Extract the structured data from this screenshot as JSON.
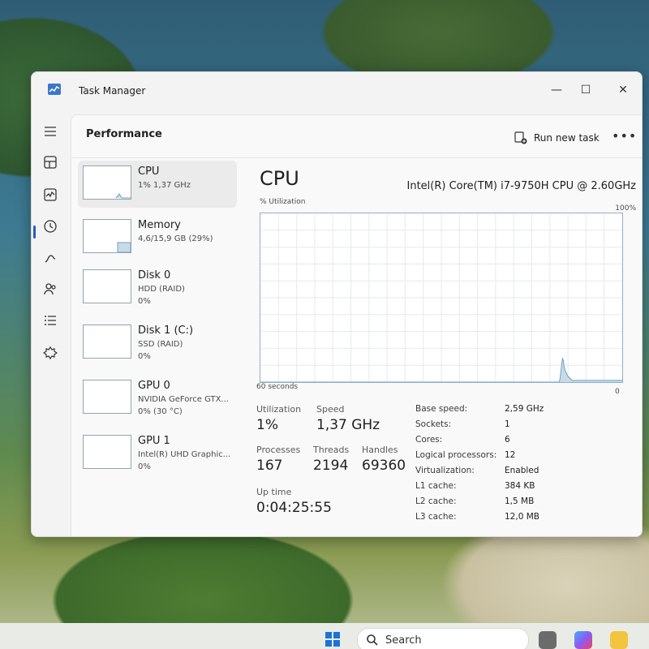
{
  "window": {
    "title": "Task Manager"
  },
  "header": {
    "title": "Performance",
    "run_task": "Run new task"
  },
  "list": [
    {
      "name": "CPU",
      "sub": "1% 1,37 GHz",
      "sub2": ""
    },
    {
      "name": "Memory",
      "sub": "4,6/15,9 GB (29%)",
      "sub2": ""
    },
    {
      "name": "Disk 0",
      "sub": "HDD (RAID)",
      "sub2": "0%"
    },
    {
      "name": "Disk 1 (C:)",
      "sub": "SSD (RAID)",
      "sub2": "0%"
    },
    {
      "name": "GPU 0",
      "sub": "NVIDIA GeForce GTX...",
      "sub2": "0% (30 °C)"
    },
    {
      "name": "GPU 1",
      "sub": "Intel(R) UHD Graphic...",
      "sub2": "0%"
    }
  ],
  "detail": {
    "title": "CPU",
    "model": "Intel(R) Core(TM) i7-9750H CPU @ 2.60GHz",
    "util_label": "% Utilization",
    "max_label": "100%",
    "secs_label": "60 seconds",
    "zero_label": "0",
    "utilization_label": "Utilization",
    "utilization": "1%",
    "speed_label": "Speed",
    "speed": "1,37 GHz",
    "processes_label": "Processes",
    "processes": "167",
    "threads_label": "Threads",
    "threads": "2194",
    "handles_label": "Handles",
    "handles": "69360",
    "uptime_label": "Up time",
    "uptime": "0:04:25:55",
    "specs": [
      {
        "label": "Base speed:",
        "value": "2,59 GHz"
      },
      {
        "label": "Sockets:",
        "value": "1"
      },
      {
        "label": "Cores:",
        "value": "6"
      },
      {
        "label": "Logical processors:",
        "value": "12"
      },
      {
        "label": "Virtualization:",
        "value": "Enabled"
      },
      {
        "label": "L1 cache:",
        "value": "384 KB"
      },
      {
        "label": "L2 cache:",
        "value": "1,5 MB"
      },
      {
        "label": "L3 cache:",
        "value": "12,0 MB"
      }
    ],
    "utilization_history": [
      0,
      0,
      0,
      0,
      0,
      0,
      0,
      0,
      0,
      0,
      0,
      0,
      0,
      0,
      0,
      0,
      0,
      0,
      0,
      0,
      0,
      0,
      0,
      0,
      0,
      0,
      0,
      0,
      0,
      0,
      0,
      0,
      0,
      0,
      0,
      0,
      0,
      0,
      0,
      0,
      0,
      0,
      0,
      0,
      0,
      0,
      0,
      0,
      0,
      0,
      0,
      0,
      0,
      0,
      0,
      0,
      0,
      0,
      0,
      0,
      0,
      0,
      0,
      0,
      0,
      0,
      0,
      0,
      0,
      0,
      0,
      0,
      0,
      0,
      0,
      0,
      0,
      0,
      0,
      0,
      0,
      0,
      0,
      0,
      0,
      0,
      0,
      0,
      0,
      0,
      0,
      0,
      0,
      0,
      0,
      0,
      0,
      0,
      0,
      0,
      0,
      0,
      0,
      0,
      0,
      0,
      0,
      0,
      0,
      0,
      0,
      0,
      0,
      0,
      0,
      0,
      0,
      0,
      0,
      0,
      0,
      0,
      0,
      0,
      0,
      0,
      0,
      0,
      0,
      0,
      0,
      0,
      0,
      0,
      0,
      0,
      0,
      0,
      0,
      0,
      0,
      0,
      0,
      0,
      0,
      0,
      0,
      0,
      0,
      0,
      0,
      0,
      0,
      0,
      0,
      0,
      0,
      0,
      0,
      0,
      0,
      0,
      0,
      0,
      0,
      0,
      0,
      0,
      0,
      0,
      0,
      0,
      0,
      0,
      0,
      0,
      0,
      0,
      0,
      0,
      0,
      0,
      0,
      0,
      0,
      0,
      0,
      0,
      0,
      0,
      0,
      0,
      0,
      0,
      0,
      0,
      0,
      0,
      0,
      0,
      0,
      0,
      0,
      0,
      0,
      0,
      0,
      0,
      0,
      0,
      0,
      0,
      0,
      0,
      0,
      0,
      0,
      0,
      0,
      0,
      0,
      0,
      0,
      0,
      0,
      0,
      0,
      0,
      0,
      0,
      0,
      0,
      0,
      0,
      0,
      0,
      0,
      0,
      0,
      0,
      0,
      0,
      0,
      0,
      0,
      0,
      0,
      0,
      0,
      0,
      0,
      0,
      0,
      0,
      0,
      0,
      0,
      0,
      0,
      0,
      0,
      0,
      0,
      0,
      0,
      0,
      0,
      0,
      0,
      0,
      0,
      0,
      0,
      0,
      0,
      0,
      0,
      0,
      0,
      0,
      0,
      0,
      0,
      0,
      0,
      0,
      0,
      0,
      0,
      0,
      0,
      0,
      0,
      0,
      0,
      0,
      0,
      0,
      0,
      0,
      0,
      0,
      0,
      0,
      0,
      0,
      0,
      0,
      0,
      0,
      0,
      0,
      0,
      0,
      0,
      0,
      0,
      0,
      0,
      0,
      0,
      0,
      0,
      0,
      0,
      0,
      0,
      0,
      0,
      0,
      0,
      0,
      0,
      0,
      0,
      0,
      0,
      0,
      0,
      0,
      0,
      0,
      0,
      0,
      0,
      0,
      0,
      0,
      0,
      0,
      0,
      0,
      0,
      0,
      0,
      0,
      0,
      0,
      0,
      0,
      0,
      2,
      6,
      10,
      14,
      13,
      9,
      7,
      6,
      5,
      4,
      3,
      3,
      2,
      2,
      1,
      1,
      1,
      1,
      1,
      1,
      1,
      1,
      1,
      1,
      1,
      1,
      1,
      1,
      1,
      1,
      1,
      1,
      1,
      1,
      1,
      1,
      1,
      1,
      1,
      1,
      1,
      1,
      1,
      1,
      1,
      1,
      1,
      1,
      1,
      1,
      1,
      1,
      1,
      1,
      1,
      1,
      1,
      1,
      1,
      1,
      1,
      1,
      1,
      1,
      1,
      1,
      1,
      1,
      1,
      1,
      1,
      1,
      1,
      1,
      1,
      1
    ]
  },
  "taskbar": {
    "search_placeholder": "Search"
  },
  "colors": {
    "accent": "#2b5cb8",
    "graph_line": "#6fa1c2",
    "graph_fill": "#c7dbe8"
  }
}
